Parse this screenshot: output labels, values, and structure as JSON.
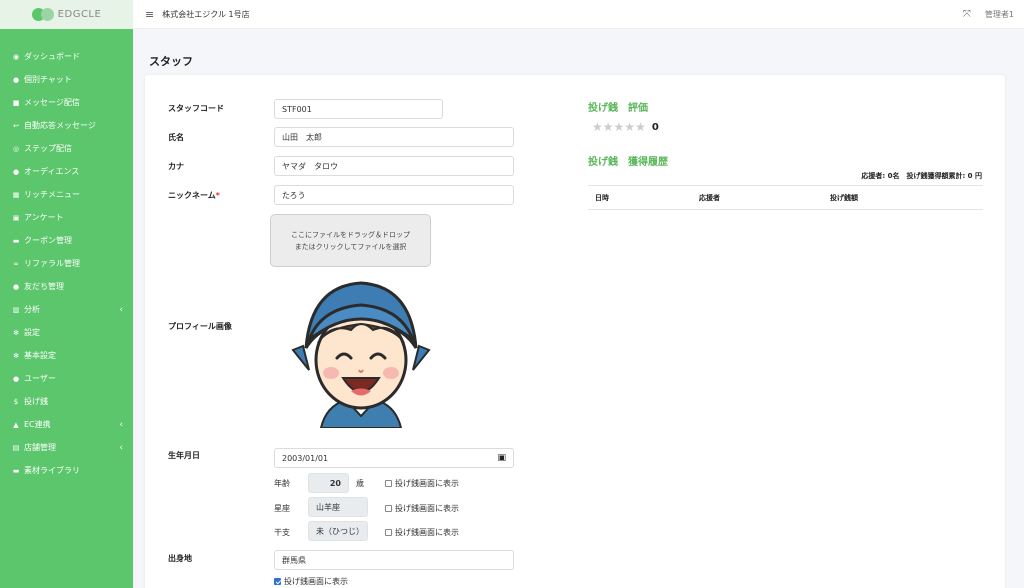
{
  "brand": {
    "name": "EDGCLE"
  },
  "topbar": {
    "store_name": "株式会社エジクル 1号店",
    "admin": "管理者1"
  },
  "sidebar": {
    "items": [
      {
        "icon": "dashboard-icon",
        "glyph": "◉",
        "label": "ダッシュボード"
      },
      {
        "icon": "chat-icon",
        "glyph": "●",
        "label": "個別チャット"
      },
      {
        "icon": "message-icon",
        "glyph": "■",
        "label": "メッセージ配信"
      },
      {
        "icon": "reply-icon",
        "glyph": "↩",
        "label": "自動応答メッセージ"
      },
      {
        "icon": "step-icon",
        "glyph": "◎",
        "label": "ステップ配信"
      },
      {
        "icon": "audience-icon",
        "glyph": "●",
        "label": "オーディエンス"
      },
      {
        "icon": "rich-menu-icon",
        "glyph": "▦",
        "label": "リッチメニュー"
      },
      {
        "icon": "survey-icon",
        "glyph": "▣",
        "label": "アンケート"
      },
      {
        "icon": "coupon-icon",
        "glyph": "▬",
        "label": "クーポン管理"
      },
      {
        "icon": "link-icon",
        "glyph": "∞",
        "label": "リファラル管理"
      },
      {
        "icon": "friends-icon",
        "glyph": "●",
        "label": "友だち管理"
      },
      {
        "icon": "analytics-icon",
        "glyph": "▥",
        "label": "分析",
        "chevron": "‹"
      },
      {
        "icon": "gear-icon",
        "glyph": "✻",
        "label": "設定"
      },
      {
        "icon": "gear-icon",
        "glyph": "✻",
        "label": "基本設定"
      },
      {
        "icon": "user-icon",
        "glyph": "●",
        "label": "ユーザー"
      },
      {
        "icon": "dollar-icon",
        "glyph": "$",
        "label": "投げ銭"
      },
      {
        "icon": "shop-icon",
        "glyph": "▲",
        "label": "EC連携",
        "chevron": "‹"
      },
      {
        "icon": "store-icon",
        "glyph": "▤",
        "label": "店舗管理",
        "chevron": "‹"
      },
      {
        "icon": "folder-icon",
        "glyph": "▬",
        "label": "素材ライブラリ"
      }
    ]
  },
  "page": {
    "title": "スタッフ"
  },
  "form": {
    "staff_code": {
      "label": "スタッフコード",
      "value": "STF001"
    },
    "name": {
      "label": "氏名",
      "value": "山田　太郎"
    },
    "kana": {
      "label": "カナ",
      "value": "ヤマダ　タロウ"
    },
    "nickname": {
      "label": "ニックネーム",
      "required_mark": "*",
      "value": "たろう"
    },
    "dropzone": {
      "line1": "ここにファイルをドラッグ＆ドロップ",
      "line2": "またはクリックしてファイルを選択"
    },
    "profile_image": {
      "label": "プロフィール画像"
    },
    "birthday": {
      "label": "生年月日",
      "value": "2003/01/01"
    },
    "age": {
      "label": "年齢",
      "value": "20",
      "unit": "歳",
      "check_label": "投げ銭画面に表示",
      "checked": false
    },
    "zodiac": {
      "label": "星座",
      "value": "山羊座",
      "check_label": "投げ銭画面に表示",
      "checked": false
    },
    "eto": {
      "label": "干支",
      "value": "未（ひつじ）",
      "check_label": "投げ銭画面に表示",
      "checked": false
    },
    "birthplace": {
      "label": "出身地",
      "value": "群馬県",
      "check_label": "投げ銭画面に表示",
      "checked": true
    }
  },
  "right": {
    "rating_title": "投げ銭　評価",
    "rating_value": "0",
    "stars": 0,
    "history_title": "投げ銭　獲得履歴",
    "summary": "応援者: 0名　投げ銭獲得額累計: 0 円",
    "columns": [
      "日時",
      "応援者",
      "投げ銭額"
    ]
  },
  "colors": {
    "sidebar": "#5cc66c",
    "accent": "#5cb85c"
  }
}
